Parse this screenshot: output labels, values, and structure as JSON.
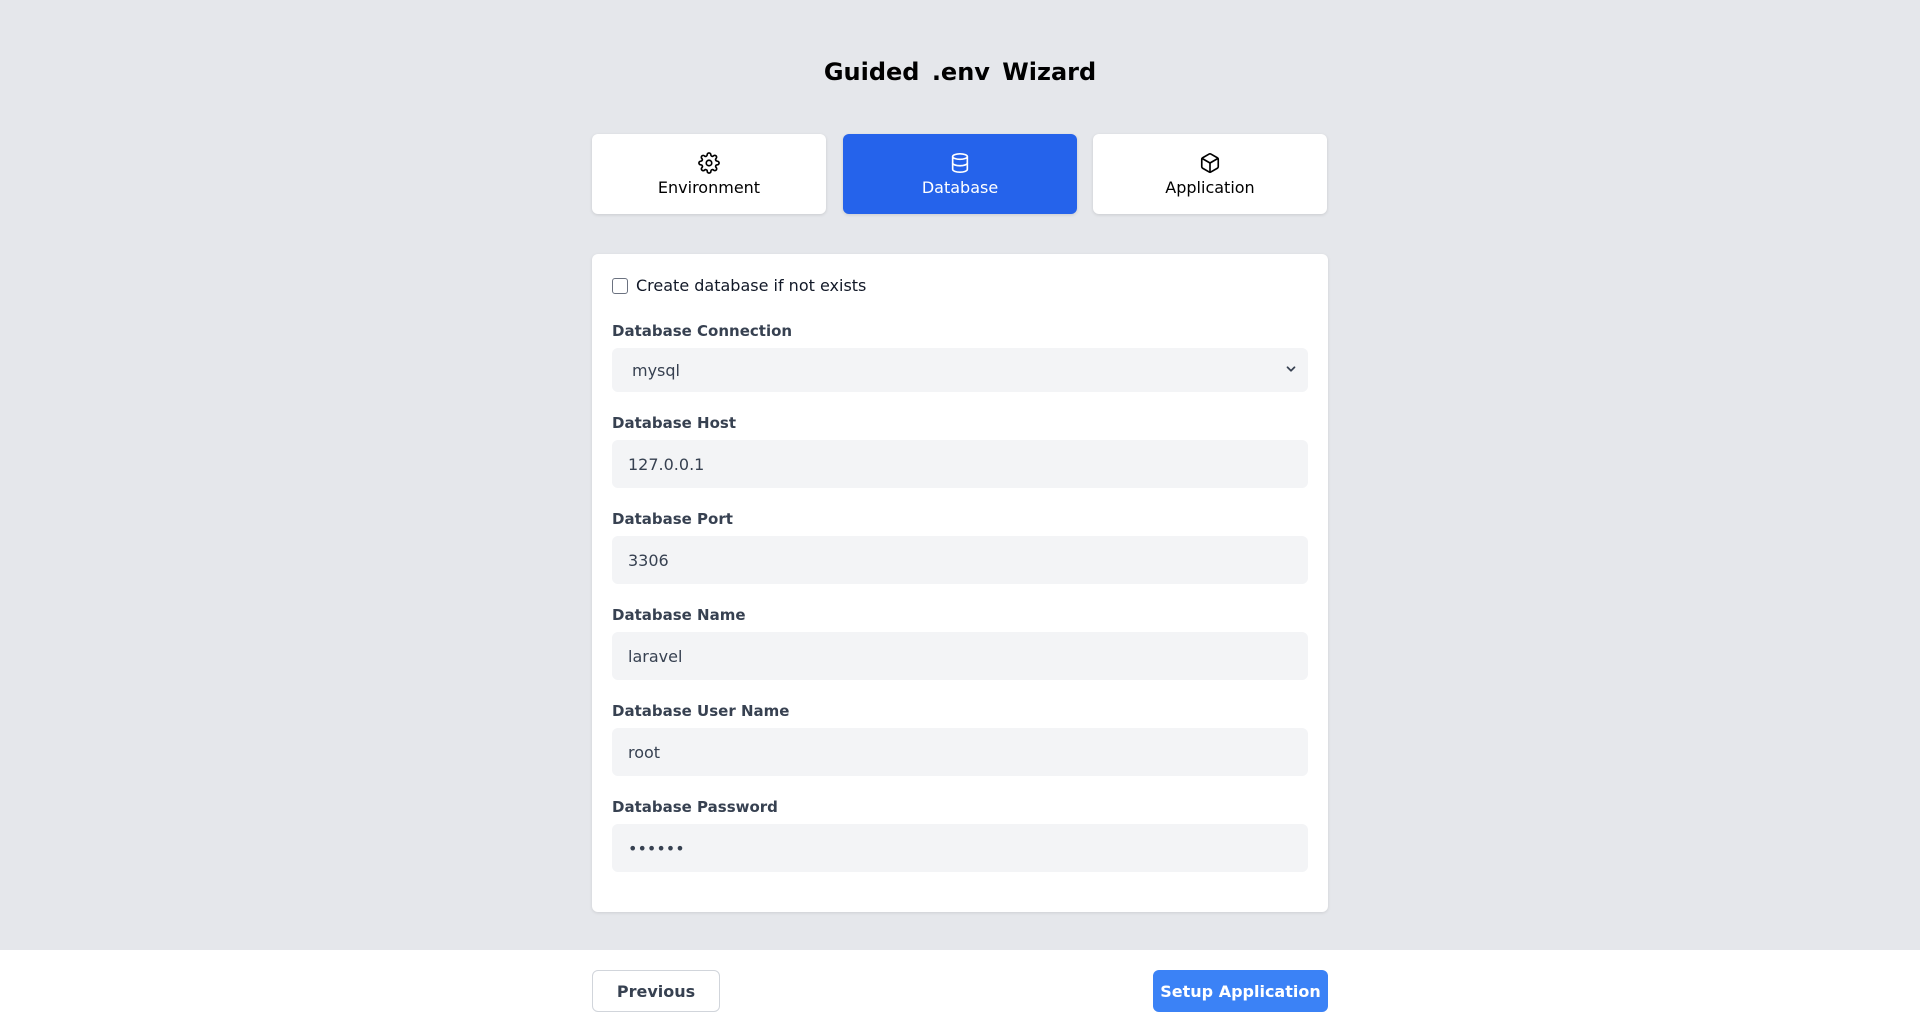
{
  "page": {
    "title": "Guided .env Wizard"
  },
  "tabs": [
    {
      "label": "Environment",
      "icon": "gear-icon",
      "active": false
    },
    {
      "label": "Database",
      "icon": "database-icon",
      "active": true
    },
    {
      "label": "Application",
      "icon": "cube-icon",
      "active": false
    }
  ],
  "form": {
    "create_db_label": "Create database if not exists",
    "create_db_checked": false,
    "connection": {
      "label": "Database Connection",
      "value": "mysql"
    },
    "host": {
      "label": "Database Host",
      "value": "127.0.0.1"
    },
    "port": {
      "label": "Database Port",
      "value": "3306"
    },
    "name": {
      "label": "Database Name",
      "value": "laravel"
    },
    "username": {
      "label": "Database User Name",
      "value": "root"
    },
    "password": {
      "label": "Database Password",
      "value": "••••••"
    }
  },
  "footer": {
    "previous_label": "Previous",
    "next_label": "Setup Application"
  },
  "colors": {
    "accent": "#2563eb",
    "button_primary": "#3b82f6",
    "background": "#e5e7eb",
    "input_bg": "#f3f4f6"
  }
}
